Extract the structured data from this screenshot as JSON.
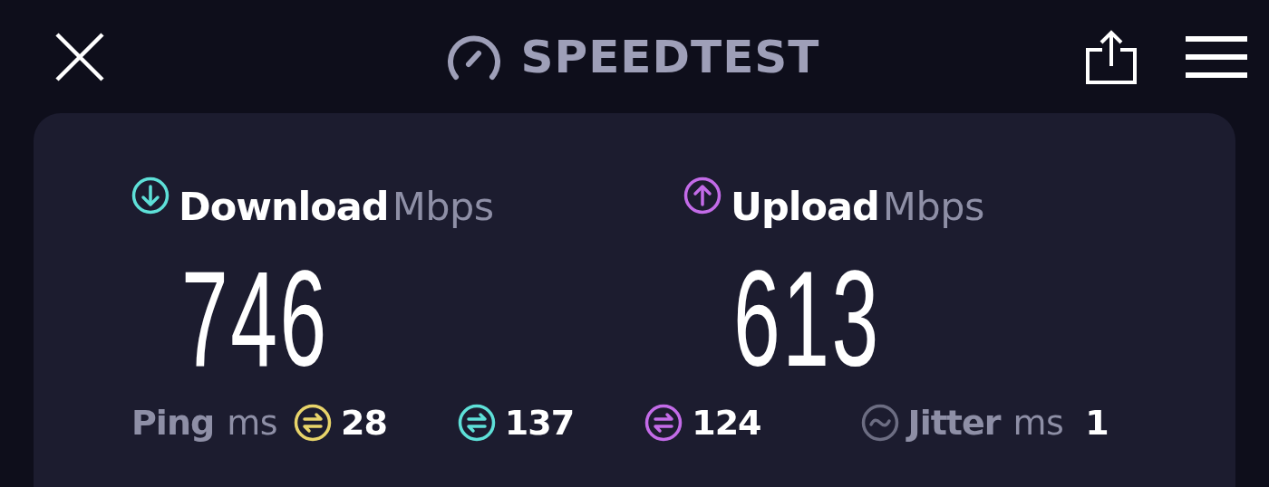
{
  "header": {
    "title": "SPEEDTEST"
  },
  "results": [
    {
      "kind": "download",
      "label": "Download",
      "unit": "Mbps",
      "value": "746",
      "color": "#5ee0d8"
    },
    {
      "kind": "upload",
      "label": "Upload",
      "unit": "Mbps",
      "value": "613",
      "color": "#c36be8"
    }
  ],
  "ping": {
    "label": "Ping",
    "unit": "ms",
    "readings": [
      {
        "value": "28",
        "color": "#e8d46a"
      },
      {
        "value": "137",
        "color": "#5ee0d8"
      },
      {
        "value": "124",
        "color": "#c36be8"
      }
    ]
  },
  "jitter": {
    "label": "Jitter",
    "unit": "ms",
    "value": "1"
  }
}
